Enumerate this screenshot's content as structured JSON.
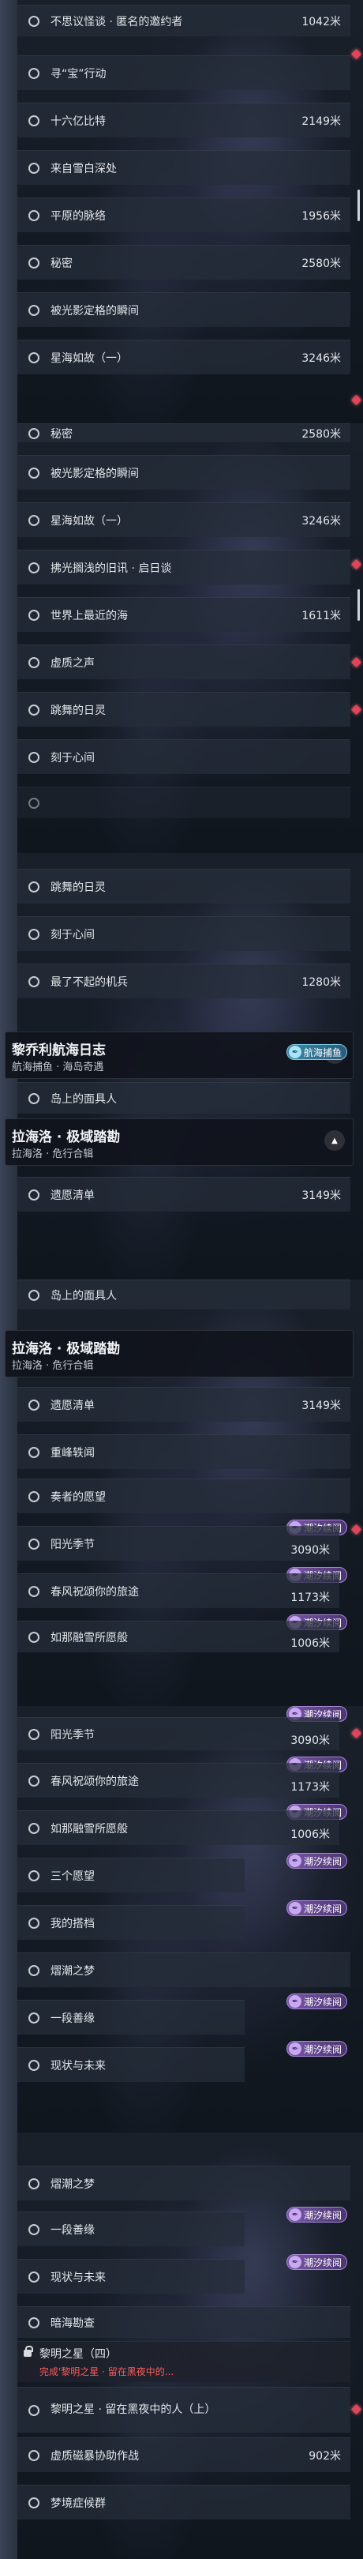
{
  "colors": {
    "accent_red": "#e04658",
    "badge_purple": "#7a58a8",
    "badge_teal": "#3a8aa8"
  },
  "badges": {
    "tide": "潮汐续阅",
    "fishing": "航海捕鱼"
  },
  "icons": {
    "badge": "quill-icon",
    "chevron": "chevron-up-icon"
  },
  "p1": [
    {
      "t": "不思议怪谈 · 匿名的邀约者",
      "d": "1042米"
    },
    {
      "t": "寻“宝”行动",
      "d": ""
    },
    {
      "t": "十六亿比特",
      "d": "2149米"
    },
    {
      "t": "来自雪白深处",
      "d": ""
    },
    {
      "t": "平原的脉络",
      "d": "1956米"
    },
    {
      "t": "秘密",
      "d": "2580米"
    },
    {
      "t": "被光影定格的瞬间",
      "d": ""
    },
    {
      "t": "星海如故（一）",
      "d": "3246米"
    }
  ],
  "p2": [
    {
      "t": "秘密",
      "d": "2580米"
    },
    {
      "t": "被光影定格的瞬间",
      "d": ""
    },
    {
      "t": "星海如故（一）",
      "d": "3246米"
    },
    {
      "t": "拂光搁浅的旧讯 · 启日谈",
      "d": ""
    },
    {
      "t": "世界上最近的海",
      "d": "1611米"
    },
    {
      "t": "虚质之声",
      "d": ""
    },
    {
      "t": "跳舞的日灵",
      "d": ""
    },
    {
      "t": "刻于心间",
      "d": ""
    }
  ],
  "p3": {
    "rows_top": [
      {
        "t": "跳舞的日灵",
        "d": ""
      },
      {
        "t": "刻于心间",
        "d": ""
      },
      {
        "t": "最了不起的机兵",
        "d": "1280米"
      }
    ],
    "h1": {
      "title": "黎乔利航海日志",
      "sub": "航海捕鱼 · 海岛奇遇"
    },
    "row_island": {
      "t": "岛上的面具人",
      "d": ""
    },
    "h2": {
      "title": "拉海洛 · 极域踏勘",
      "sub": "拉海洛 · 危行合辑"
    },
    "row_ruins": {
      "t": "遗愿清单",
      "d": "3149米"
    }
  },
  "p4": {
    "row_island": {
      "t": "岛上的面具人",
      "d": ""
    },
    "h": {
      "title": "拉海洛 · 极域踏勘",
      "sub": "拉海洛 · 危行合辑"
    },
    "rows": [
      {
        "t": "遗愿清单",
        "d": "3149米"
      },
      {
        "t": "重峰轶闻",
        "d": ""
      },
      {
        "t": "奏者的愿望",
        "d": ""
      },
      {
        "t": "阳光季节",
        "d": "3090米"
      },
      {
        "t": "春风祝颂你的旅途",
        "d": "1173米"
      },
      {
        "t": "如那融雪所愿般",
        "d": "1006米"
      }
    ]
  },
  "p5": [
    {
      "t": "阳光季节",
      "d": "3090米"
    },
    {
      "t": "春风祝颂你的旅途",
      "d": "1173米"
    },
    {
      "t": "如那融雪所愿般",
      "d": "1006米"
    },
    {
      "t": "三个愿望",
      "d": ""
    },
    {
      "t": "我的搭档",
      "d": ""
    },
    {
      "t": "熠潮之梦",
      "d": ""
    },
    {
      "t": "一段善缘",
      "d": ""
    },
    {
      "t": "现状与未来",
      "d": ""
    }
  ],
  "p6": {
    "rows": [
      {
        "t": "熠潮之梦",
        "d": ""
      },
      {
        "t": "一段善缘",
        "d": ""
      },
      {
        "t": "现状与未来",
        "d": ""
      },
      {
        "t": "暗海勘查",
        "d": ""
      }
    ],
    "locked": {
      "t": "黎明之星（四）",
      "sub": "完成'黎明之星 · 留在黑夜中的..."
    },
    "rows2": [
      {
        "t": "黎明之星 · 留在黑夜中的人（上）",
        "d": ""
      },
      {
        "t": "虚质磁暴协助作战",
        "d": "902米"
      },
      {
        "t": "梦境症候群",
        "d": ""
      }
    ]
  }
}
